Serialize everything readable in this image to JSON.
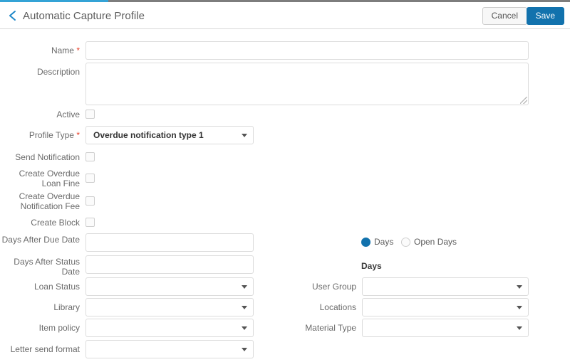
{
  "progress": {
    "percent": 19
  },
  "header": {
    "back_icon": "chevron-left-icon",
    "title": "Automatic Capture Profile",
    "cancel_label": "Cancel",
    "save_label": "Save",
    "accent_color": "#1272ad",
    "progress_color": "#34a3d6"
  },
  "required_marker": "*",
  "form": {
    "left": [
      {
        "label": "Name",
        "required": true,
        "type": "input",
        "value": ""
      },
      {
        "label": "Description",
        "required": false,
        "type": "textarea",
        "value": ""
      },
      {
        "label": "Active",
        "required": false,
        "type": "checkbox",
        "checked": false
      },
      {
        "label": "Profile Type",
        "required": true,
        "type": "select",
        "value": "Overdue notification type 1"
      },
      {
        "label": "Send Notification",
        "required": false,
        "type": "checkbox",
        "checked": false
      },
      {
        "label": "Create Overdue Loan Fine",
        "required": false,
        "type": "checkbox",
        "checked": false
      },
      {
        "label": "Create Overdue Notification Fee",
        "required": false,
        "type": "checkbox",
        "checked": false
      },
      {
        "label": "Create Block",
        "required": false,
        "type": "checkbox",
        "checked": false
      },
      {
        "label": "Days After Due Date",
        "required": false,
        "type": "input",
        "value": ""
      },
      {
        "label": "Days After Status Date",
        "required": false,
        "type": "input",
        "value": ""
      },
      {
        "label": "Loan Status",
        "required": false,
        "type": "select",
        "value": ""
      },
      {
        "label": "Library",
        "required": false,
        "type": "select",
        "value": ""
      },
      {
        "label": "Item policy",
        "required": false,
        "type": "select",
        "value": ""
      },
      {
        "label": "Letter send format",
        "required": false,
        "type": "select",
        "value": ""
      }
    ],
    "right": {
      "day_type": {
        "name": "day-type",
        "options": [
          {
            "label": "Days",
            "selected": true
          },
          {
            "label": "Open Days",
            "selected": false
          }
        ]
      },
      "group_heading": "Days",
      "selects": [
        {
          "label": "User Group",
          "value": ""
        },
        {
          "label": "Locations",
          "value": ""
        },
        {
          "label": "Material Type",
          "value": ""
        }
      ]
    }
  }
}
